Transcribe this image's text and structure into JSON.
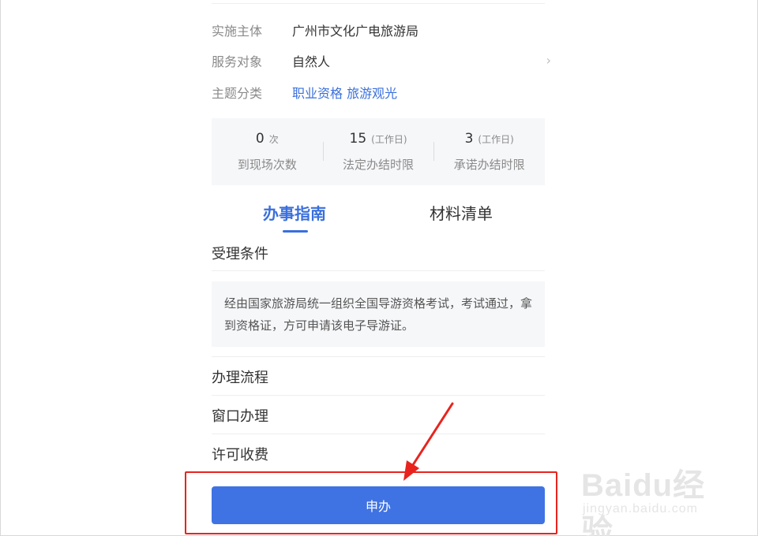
{
  "info": [
    {
      "label": "实施主体",
      "value": "广州市文化广电旅游局"
    },
    {
      "label": "服务对象",
      "value": "自然人"
    },
    {
      "label": "主题分类",
      "value": "职业资格 旅游观光"
    }
  ],
  "stats": [
    {
      "number": "0",
      "unit": "次",
      "label": "到现场次数"
    },
    {
      "number": "15",
      "unit": "(工作日)",
      "label": "法定办结时限"
    },
    {
      "number": "3",
      "unit": "(工作日)",
      "label": "承诺办结时限"
    }
  ],
  "tabs": [
    {
      "label": "办事指南",
      "active": true
    },
    {
      "label": "材料清单",
      "active": false
    }
  ],
  "sections": {
    "conditions_title": "受理条件",
    "conditions_text": "经由国家旅游局统一组织全国导游资格考试，考试通过，拿到资格证，方可申请该电子导游证。",
    "process": "办理流程",
    "window": "窗口办理",
    "fee": "许可收费"
  },
  "apply_button": "申办",
  "watermark": {
    "brand": "Baidu经验",
    "url": "jingyan.baidu.com"
  },
  "colors": {
    "accent": "#3a6fdc",
    "button": "#3f73e3",
    "highlight": "#e8231e"
  },
  "icons": {
    "chevron": "chevron-right-icon",
    "arrow": "red-arrow-icon"
  }
}
